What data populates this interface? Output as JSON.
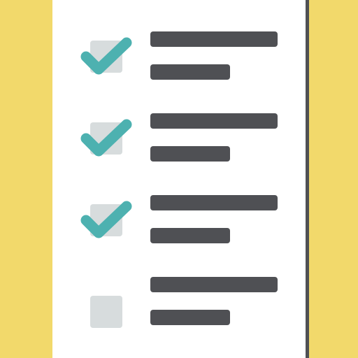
{
  "colors": {
    "background": "#f2d96b",
    "paper": "#ffffff",
    "paper_edge": "#4f5054",
    "checkbox": "#d7dcdd",
    "check": "#4db1b0",
    "text_line": "#4f5054"
  },
  "icon": {
    "name": "checklist-icon"
  },
  "items": [
    {
      "checked": true,
      "icon": "checkmark-icon"
    },
    {
      "checked": true,
      "icon": "checkmark-icon"
    },
    {
      "checked": true,
      "icon": "checkmark-icon"
    },
    {
      "checked": false,
      "icon": "empty-checkbox-icon"
    }
  ]
}
